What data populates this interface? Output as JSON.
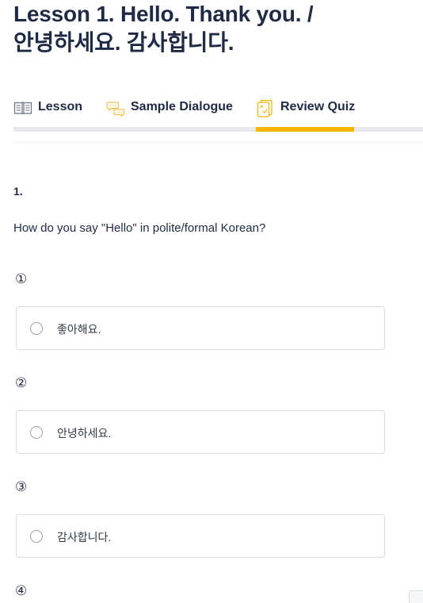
{
  "page": {
    "title_line1": "Lesson 1. Hello. Thank you. /",
    "title_line2": "안녕하세요. 감사합니다."
  },
  "tabs": [
    {
      "label": "Lesson",
      "icon": "book-icon",
      "active": false
    },
    {
      "label": "Sample Dialogue",
      "icon": "chat-bubbles-icon",
      "active": false
    },
    {
      "label": "Review Quiz",
      "icon": "quiz-card-icon",
      "active": true
    }
  ],
  "colors": {
    "accent": "#f7b500",
    "title": "#1f2a44",
    "track": "#e6e8ec",
    "border": "#d9dce1"
  },
  "question": {
    "number": "1.",
    "text": "How do you say \"Hello\" in polite/formal Korean?",
    "options": [
      {
        "marker": "①",
        "label": "좋아해요."
      },
      {
        "marker": "②",
        "label": "안녕하세요."
      },
      {
        "marker": "③",
        "label": "감사합니다."
      },
      {
        "marker": "④",
        "label": ""
      }
    ]
  }
}
